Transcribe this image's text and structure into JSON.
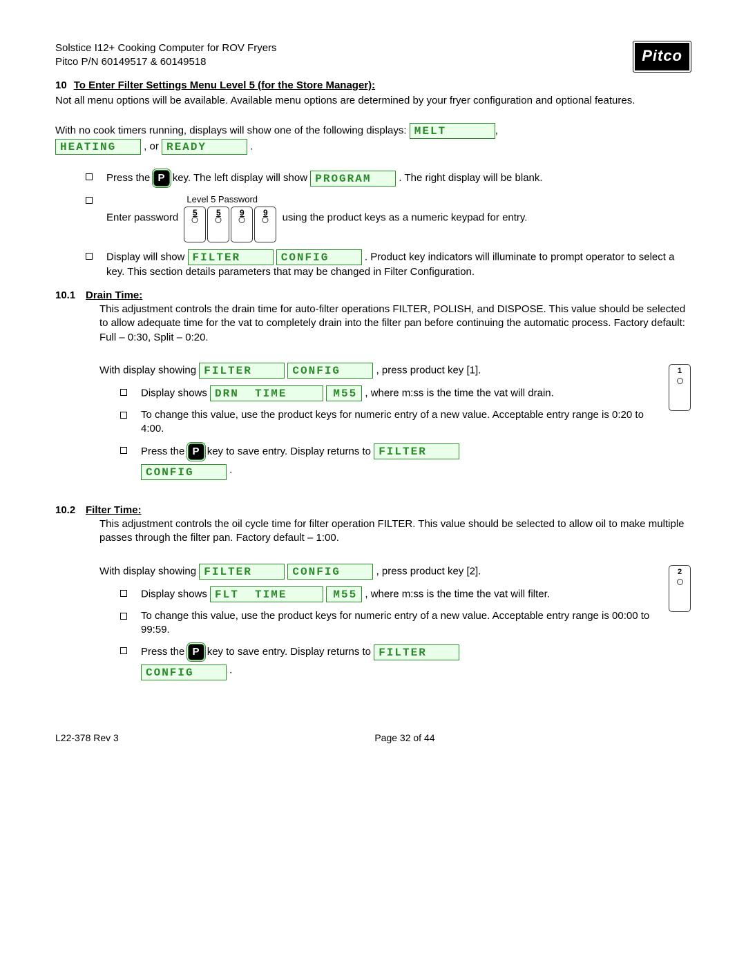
{
  "header": {
    "line1": "Solstice I12+ Cooking Computer for ROV Fryers",
    "line2": "Pitco P/N 60149517 & 60149518",
    "logo": "Pitco"
  },
  "section": {
    "num": "10",
    "title": "To Enter Filter Settings Menu Level 5 (for the Store Manager):",
    "intro": "Not all menu options will be available.  Available menu options are determined by your fryer configuration and optional features.",
    "lead_pre": "With no cook timers running, displays will show one of the following displays:  ",
    "lead_or": ", or ",
    "lead_end": "."
  },
  "lcd": {
    "melt": "MELT",
    "heating": "HEATING",
    "ready": "READY",
    "program": "PROGRAM",
    "filter": "FILTER",
    "config": "CONFIG",
    "drn_time": "DRN  TIME",
    "flt_time": "FLT  TIME",
    "mss": "M55"
  },
  "keys": {
    "p": "P"
  },
  "keypad": {
    "label": "Level 5 Password",
    "digits": [
      "5",
      "5",
      "9",
      "9"
    ]
  },
  "steps": {
    "s1a": "Press the ",
    "s1b": " key.  The left display will show ",
    "s1c": ".  The right display will be blank.",
    "s2a": "Enter password ",
    "s2b": " using the product keys as a numeric keypad for entry.",
    "s3a": "Display will show ",
    "s3b": ".  Product key indicators will illuminate to prompt operator to select a key.  This section details parameters that may be changed in Filter Configuration."
  },
  "sub101": {
    "num": "10.1",
    "title": "Drain Time:",
    "body": "This adjustment controls the drain time for auto-filter operations FILTER, POLISH, and DISPOSE.  This value should be selected to allow adequate time for the vat to completely drain into the filter pan before continuing the automatic process.  Factory default: Full – 0:30, Split – 0:20.",
    "lead_a": "With display showing ",
    "lead_b": ", press product key [1].",
    "keynum": "1",
    "b1a": "Display shows ",
    "b1b": ", where m:ss is the time the vat will drain.",
    "b2": "To change this value, use the product keys for numeric entry of a new value.  Acceptable entry range is 0:20 to 4:00.",
    "b3a": "Press the ",
    "b3b": " key to save entry.  Display returns to ",
    "b3c": "."
  },
  "sub102": {
    "num": "10.2",
    "title": "Filter Time:",
    "body": "This adjustment controls the oil cycle time for filter operation FILTER.  This value should be selected to allow oil to make multiple passes through the filter pan.  Factory default – 1:00.",
    "lead_a": "With display showing ",
    "lead_b": ", press product key [2].",
    "keynum": "2",
    "b1a": "Display shows ",
    "b1b": ", where m:ss is the time the vat will filter.",
    "b2": "To change this value, use the product keys for numeric entry of a new value.  Acceptable entry range is 00:00 to 99:59.",
    "b3a": "Press the ",
    "b3b": " key to save entry.  Display returns to ",
    "b3c": "."
  },
  "footer": {
    "left": "L22-378 Rev 3",
    "center": "Page 32 of 44"
  }
}
